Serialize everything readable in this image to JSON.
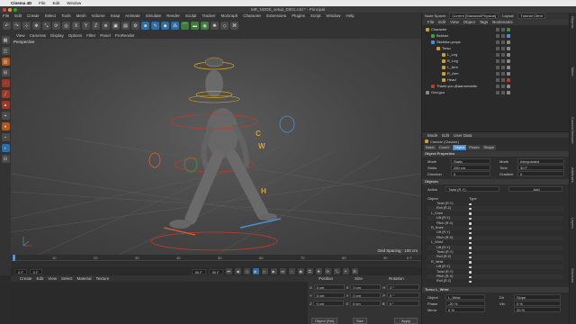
{
  "mac_menubar": {
    "app": "Cinema 4D",
    "items": [
      "File",
      "Edit",
      "Window"
    ]
  },
  "window": {
    "title": "MR_NODE_setup_D001.c4d * - Principal"
  },
  "c4d_menu": {
    "items": [
      "File",
      "Edit",
      "Create",
      "Select",
      "Tools",
      "Mesh",
      "Volume",
      "Snap",
      "Animate",
      "Simulate",
      "Render",
      "Sculpt",
      "Tracker",
      "MoGraph",
      "Character",
      "Extensions",
      "Plugins",
      "Script",
      "Window",
      "Help"
    ],
    "right_items": [
      "Node Spacer",
      "Current [Standard/Physical]",
      "Layout:",
      "Tutorial Client"
    ]
  },
  "viewport": {
    "menu": [
      "View",
      "Cameras",
      "Display",
      "Options",
      "Filter",
      "Panel",
      "ProRender"
    ],
    "label": "Perspective",
    "grid_spacing": "Grid Spacing : 100 cm",
    "letters": [
      "C",
      "W",
      "H"
    ]
  },
  "timeline": {
    "ticks": [
      "0",
      "10",
      "20",
      "30",
      "40",
      "50",
      "60",
      "70",
      "80",
      "90"
    ],
    "frame_end_marker": "0 F",
    "start": "0 F",
    "current": "0 F",
    "end_a": "90 F",
    "end_b": "90 F"
  },
  "materials": {
    "menu": [
      "Create",
      "Edit",
      "View",
      "Select",
      "Material",
      "Texture"
    ]
  },
  "coordinates": {
    "headers": [
      "Position",
      "Size",
      "Rotation"
    ],
    "rows": [
      {
        "axis": "X",
        "pos": "0 cm",
        "size_axis": "X",
        "size": "0 cm",
        "rot_axis": "H",
        "rot": "0 °"
      },
      {
        "axis": "Y",
        "pos": "0 cm",
        "size_axis": "Y",
        "size": "0 cm",
        "rot_axis": "P",
        "rot": "0 °"
      },
      {
        "axis": "Z",
        "pos": "0 cm",
        "size_axis": "Z",
        "size": "0 cm",
        "rot_axis": "B",
        "rot": "0 °"
      }
    ],
    "mode_select": "Object (Rel)",
    "size_select": "Size",
    "apply": "Apply"
  },
  "object_manager": {
    "menu": [
      "File",
      "Edit",
      "View",
      "Object",
      "Tags",
      "Bookmarks"
    ],
    "objects": [
      {
        "name": "Character",
        "indent": 0,
        "color": "#c9a227",
        "tag": "#3a8f3a"
      },
      {
        "name": "Bekken",
        "indent": 1,
        "color": "#3f9e3f",
        "tag": "#4a8fd6"
      },
      {
        "name": "Skeleton.props",
        "indent": 1,
        "color": "#4a8fd6",
        "tag": "#888888"
      },
      {
        "name": "Torso",
        "indent": 2,
        "color": "#c9a227",
        "tag": "#888888"
      },
      {
        "name": "L_Leg",
        "indent": 3,
        "color": "#c9a227",
        "tag": "#888888"
      },
      {
        "name": "R_Leg",
        "indent": 3,
        "color": "#c9a227",
        "tag": "#888888"
      },
      {
        "name": "L_Arm",
        "indent": 3,
        "color": "#c9a227",
        "tag": "#888888"
      },
      {
        "name": "R_Arm",
        "indent": 3,
        "color": "#c9a227",
        "tag": "#888888"
      },
      {
        "name": "Head",
        "indent": 3,
        "color": "#c9a227",
        "tag": "#c0392b"
      },
      {
        "name": "Thank you @aaronmartin",
        "indent": 1,
        "color": "#c0392b",
        "tag": "#888888"
      },
      {
        "name": "Grid.gco",
        "indent": 0,
        "color": "#888888",
        "tag": "#888888"
      }
    ]
  },
  "attributes": {
    "menu": [
      "Mode",
      "Edit",
      "User Data"
    ],
    "title": "Clavicle (Clavicle)",
    "tabs": [
      "Basic",
      "Coord.",
      "Object",
      "Poses",
      "Shape"
    ],
    "active_tab": "Object",
    "section_object": "Object Properties",
    "fields": [
      {
        "label": "Mode",
        "value": "Static"
      },
      {
        "label": "Strids",
        "value": "250 cm"
      },
      {
        "label": "Direction",
        "value": "0"
      }
    ],
    "fields_right": [
      {
        "label": "Mode",
        "value": "Interpolated"
      },
      {
        "label": "Time",
        "value": "30 F"
      },
      {
        "label": "Gradient",
        "value": "0"
      }
    ],
    "section_objects": "Objects",
    "action_label": "Action",
    "action_value": "Twist (R.Y)",
    "add_label": "Add",
    "table_headers": [
      "Object",
      "Type"
    ],
    "table_rows": [
      "Twist (R.Y)",
      "Roll (R.Z)",
      "L_Knee",
      "Lift (R.Y)",
      "Pitch (R.X)",
      "R_Knee",
      "Lift (R.Y)",
      "Pitch (R.X)",
      "L_Wrist",
      "Lift (R.Y)",
      "Twist (R.Y)",
      "Roll (R.Z)",
      "R_Wrist",
      "Lift (R.Y)",
      "Twist (R.Y)",
      "Pitch (R.X)",
      "Roll (R.Z)"
    ],
    "section_lower": "Torso L_Wrist",
    "lower_fields": [
      {
        "label": "Object",
        "value": "L_Wrist"
      },
      {
        "label": "Phase",
        "value": "-20 %"
      },
      {
        "label": "Mirror",
        "value": "0 %"
      }
    ],
    "lower_fields_right": [
      {
        "label": "Dir",
        "value": "Slope"
      },
      {
        "label": "Vib.",
        "value": "0 %"
      },
      {
        "label": "",
        "value": "20 %"
      }
    ]
  },
  "side_tabs": [
    "Objects",
    "Takes",
    "Content Browser",
    "Attributes",
    "Layers",
    "Structure"
  ]
}
